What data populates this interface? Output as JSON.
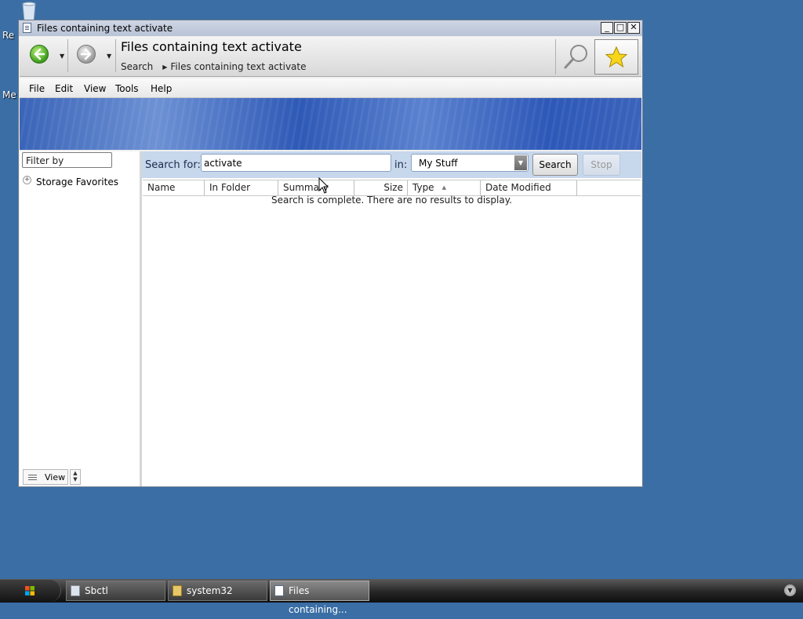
{
  "desktop": {
    "icon_labels": [
      "Re",
      "Me"
    ]
  },
  "window": {
    "title": "Files containing text activate",
    "controls": {
      "minimize": "_",
      "maximize": "□",
      "close": "✕"
    }
  },
  "navbar": {
    "title": "Files containing text activate",
    "breadcrumb": [
      "Search",
      "Files containing text activate"
    ]
  },
  "menu": [
    "File",
    "Edit",
    "View",
    "Tools",
    "Help"
  ],
  "left_pane": {
    "filter_placeholder": "Filter by",
    "tree_item": "Storage Favorites",
    "view_label": "View"
  },
  "search": {
    "label": "Search for:",
    "query": "activate",
    "in_label": "in:",
    "location": "My Stuff",
    "search_button": "Search",
    "stop_button": "Stop"
  },
  "results": {
    "columns": [
      "Name",
      "In Folder",
      "Summary",
      "Size",
      "Type",
      "Date Modified"
    ],
    "sort_column": "Type",
    "message": "Search is complete. There are no results to display."
  },
  "taskbar": {
    "tasks": [
      "Sbctl",
      "system32",
      "Files containing..."
    ],
    "active_task": "Files containing..."
  },
  "colors": {
    "desktop": "#3a6ea5",
    "banner": "#3a64b8",
    "searchbar": "#c7d7ec"
  }
}
